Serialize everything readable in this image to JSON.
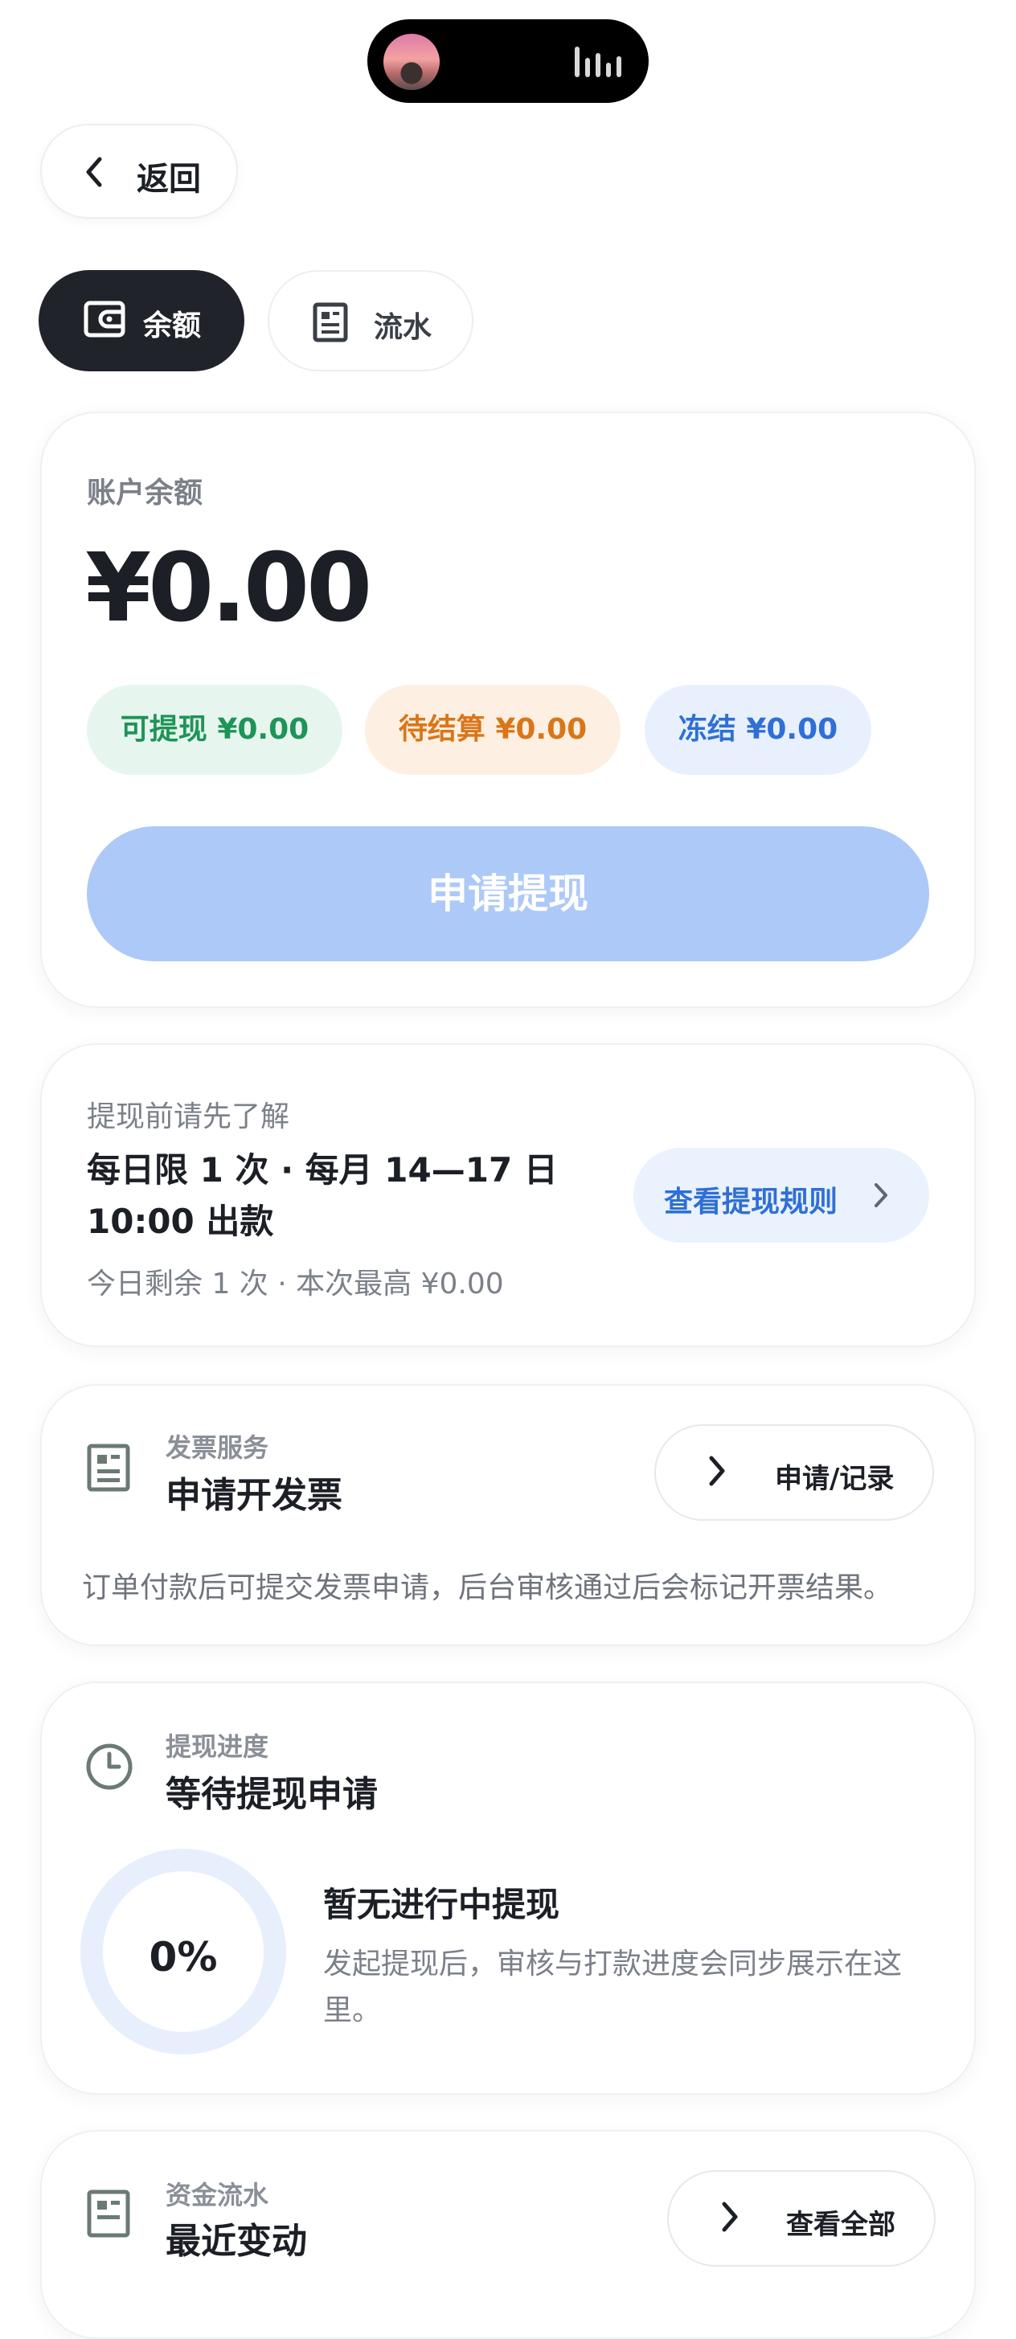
{
  "header": {
    "back_label": "返回"
  },
  "tabs": [
    {
      "label": "余额",
      "icon": "wallet-icon",
      "active": true
    },
    {
      "label": "流水",
      "icon": "document-icon",
      "active": false
    }
  ],
  "balance_card": {
    "label": "账户余额",
    "amount": "¥0.00",
    "pills": [
      {
        "label": "可提现 ¥0.00",
        "color": "#1e9457",
        "bg": "#e6f6ee"
      },
      {
        "label": "待结算 ¥0.00",
        "color": "#d9761a",
        "bg": "#fdf0e2"
      },
      {
        "label": "冻结 ¥0.00",
        "color": "#2f6fd6",
        "bg": "#e8f0fd"
      }
    ],
    "withdraw_button": "申请提现"
  },
  "rules_card": {
    "pre_label": "提现前请先了解",
    "rule_line1": "每日限 1 次 · 每月 14—17 日",
    "rule_line2": "10:00 出款",
    "remaining": "今日剩余 1 次 · 本次最高 ¥0.00",
    "rules_button": "查看提现规则"
  },
  "invoice_card": {
    "subtitle": "发票服务",
    "title": "申请开发票",
    "button": "申请/记录",
    "description": "订单付款后可提交发票申请，后台审核通过后会标记开票结果。"
  },
  "progress_card": {
    "subtitle": "提现进度",
    "title": "等待提现申请",
    "percent": "0%",
    "progress_value": 0,
    "status_title": "暂无进行中提现",
    "status_desc_line1": "发起提现后，审核与打款进度会同步展示在这",
    "status_desc_line2": "里。"
  },
  "flow_card": {
    "subtitle": "资金流水",
    "title": "最近变动",
    "button": "查看全部"
  }
}
